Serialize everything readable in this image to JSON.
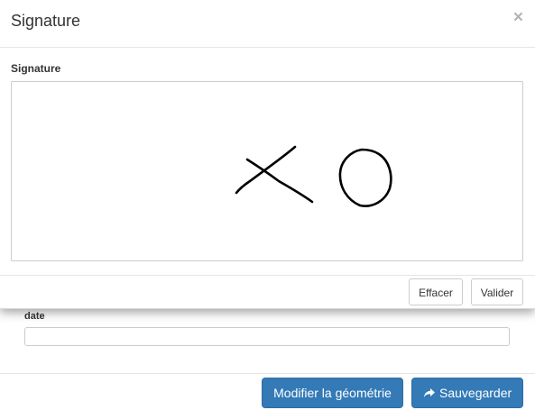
{
  "modal": {
    "title": "Signature",
    "close_symbol": "×",
    "signature_label": "Signature",
    "clear_label": "Effacer",
    "validate_label": "Valider"
  },
  "form": {
    "date_label": "date",
    "date_value": "",
    "modify_geometry_label": "Modifier la géométrie",
    "save_label": "Sauvegarder",
    "save_icon": "share-icon"
  },
  "colors": {
    "primary": "#337ab7",
    "primary_border": "#2e6da4",
    "ink": "#000000"
  }
}
